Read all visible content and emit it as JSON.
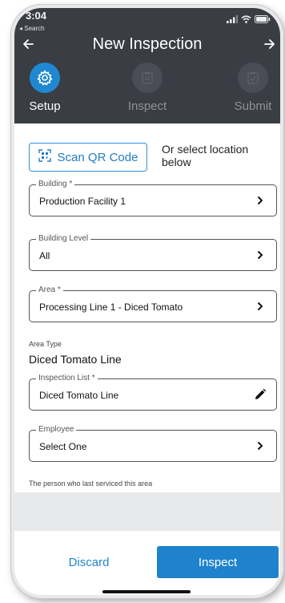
{
  "status_bar": {
    "time": "3:04",
    "back_app": "◂ Search",
    "signal_icon": "signal-icon",
    "wifi_icon": "wifi-icon",
    "battery_icon": "battery-icon"
  },
  "nav": {
    "title": "New Inspection",
    "back_icon": "arrow-left-icon",
    "forward_icon": "arrow-right-icon"
  },
  "steps": [
    {
      "label": "Setup",
      "icon": "gear-icon",
      "state": "active"
    },
    {
      "label": "Inspect",
      "icon": "clipboard-icon",
      "state": "inactive"
    },
    {
      "label": "Submit",
      "icon": "clipboard-check-icon",
      "state": "inactive"
    }
  ],
  "scan": {
    "label": "Scan QR Code",
    "icon": "qr-code-icon",
    "or_text": "Or select location below"
  },
  "fields": {
    "building": {
      "label": "Building *",
      "value": "Production Facility 1"
    },
    "building_level": {
      "label": "Building Level",
      "value": "All"
    },
    "area": {
      "label": "Area *",
      "value": "Processing Line 1 - Diced Tomato"
    },
    "inspection_list": {
      "label": "Inspection List *",
      "value": "Diced Tomato Line"
    },
    "employee": {
      "label": "Employee",
      "value": "Select One"
    }
  },
  "area_type": {
    "label": "Area Type",
    "value": "Diced Tomato Line"
  },
  "employee_helper": "The person who last serviced this area",
  "footer": {
    "discard_label": "Discard",
    "inspect_label": "Inspect"
  },
  "colors": {
    "header_bg": "#3a3d44",
    "accent": "#1f88d0",
    "inactive_step": "#4a4d55"
  }
}
